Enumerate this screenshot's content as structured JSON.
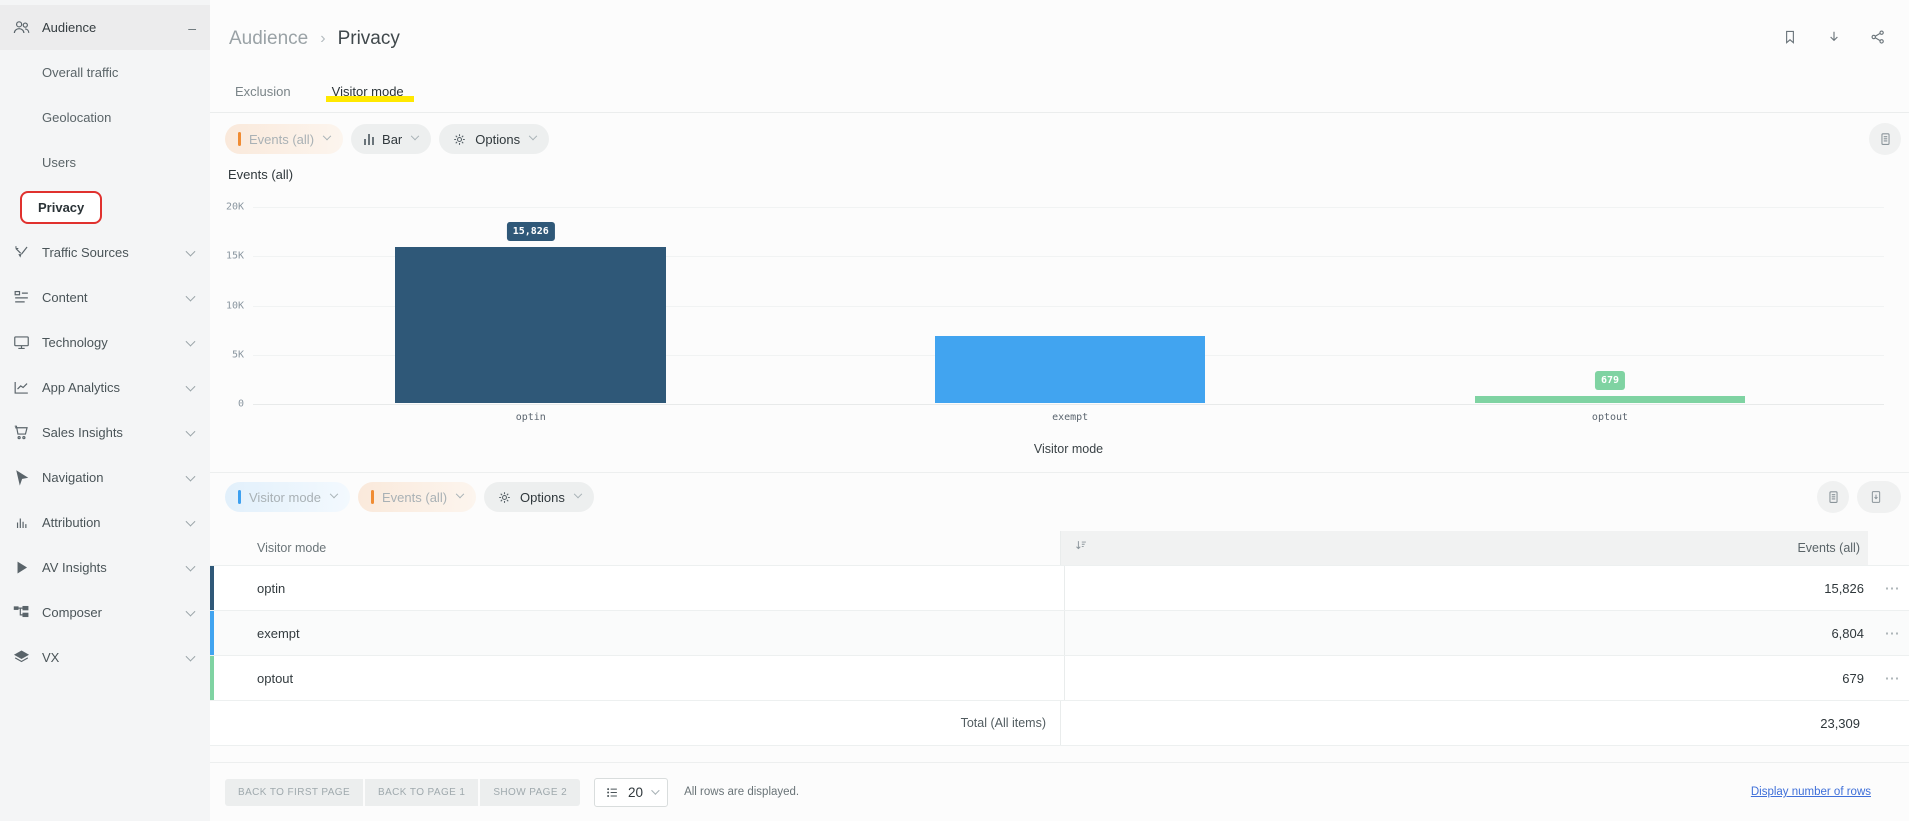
{
  "colors": {
    "orange_accent": "#F08C33",
    "blue_accent": "#3DA0F0",
    "yellow_highlight": "#FFE800",
    "red_annotation": "#E0312E",
    "link_blue": "#3E6FD9"
  },
  "sidebar": {
    "collapse_glyph": "–",
    "items": [
      {
        "label": "Audience"
      },
      {
        "label": "Overall traffic"
      },
      {
        "label": "Geolocation"
      },
      {
        "label": "Users"
      },
      {
        "label": "Privacy"
      },
      {
        "label": "Traffic Sources"
      },
      {
        "label": "Content"
      },
      {
        "label": "Technology"
      },
      {
        "label": "App Analytics"
      },
      {
        "label": "Sales Insights"
      },
      {
        "label": "Navigation"
      },
      {
        "label": "Attribution"
      },
      {
        "label": "AV Insights"
      },
      {
        "label": "Composer"
      },
      {
        "label": "VX"
      }
    ]
  },
  "header": {
    "breadcrumb_parent": "Audience",
    "breadcrumb_separator": "›",
    "breadcrumb_current": "Privacy"
  },
  "tabs": {
    "tab1": "Exclusion",
    "tab2": "Visitor mode"
  },
  "chart_toolbar": {
    "metric_chip": "Events (all)",
    "type_chip": "Bar",
    "options_chip": "Options"
  },
  "chart_data": {
    "type": "bar",
    "title": "Events (all)",
    "categories": [
      "optin",
      "exempt",
      "optout"
    ],
    "values": [
      15826,
      6804,
      679
    ],
    "value_labels": [
      "15,826",
      "",
      "679"
    ],
    "bar_colors": [
      "#2F5878",
      "#41A4F0",
      "#7FD3A2"
    ],
    "xlabel": "Visitor mode",
    "ylabel": "",
    "ylim": [
      0,
      20000
    ],
    "yticks": [
      "20K",
      "15K",
      "10K",
      "5K",
      "0"
    ],
    "grid": true,
    "legend": false
  },
  "table_toolbar": {
    "dimension_chip": "Visitor mode",
    "metric_chip": "Events (all)",
    "options_chip": "Options"
  },
  "table": {
    "col_dimension": "Visitor mode",
    "col_metric": "Events (all)",
    "rows": [
      {
        "label": "optin",
        "value": "15,826",
        "color": "#2F5878"
      },
      {
        "label": "exempt",
        "value": "6,804",
        "color": "#41A4F0"
      },
      {
        "label": "optout",
        "value": "679",
        "color": "#7FD3A2"
      }
    ],
    "total_label": "Total (All items)",
    "total_value": "23,309",
    "row_menu_glyph": "⋯"
  },
  "pagination": {
    "btn_first": "BACK TO FIRST PAGE",
    "btn_page1": "BACK TO PAGE 1",
    "btn_page2": "SHOW PAGE 2",
    "page_size": "20",
    "status": "All rows are displayed.",
    "link": "Display number of rows"
  }
}
